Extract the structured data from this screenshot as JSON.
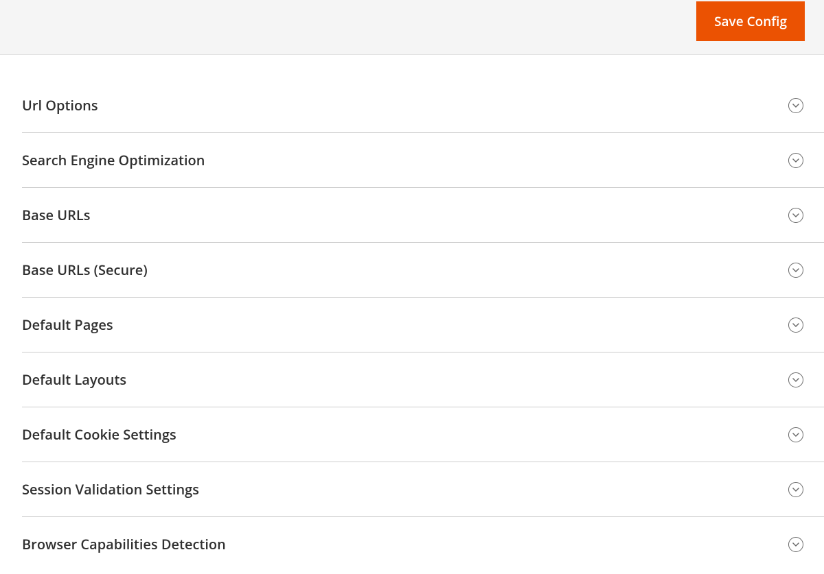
{
  "toolbar": {
    "save_label": "Save Config"
  },
  "sections": [
    {
      "title": "Url Options"
    },
    {
      "title": "Search Engine Optimization"
    },
    {
      "title": "Base URLs"
    },
    {
      "title": "Base URLs (Secure)"
    },
    {
      "title": "Default Pages"
    },
    {
      "title": "Default Layouts"
    },
    {
      "title": "Default Cookie Settings"
    },
    {
      "title": "Session Validation Settings"
    },
    {
      "title": "Browser Capabilities Detection"
    }
  ]
}
